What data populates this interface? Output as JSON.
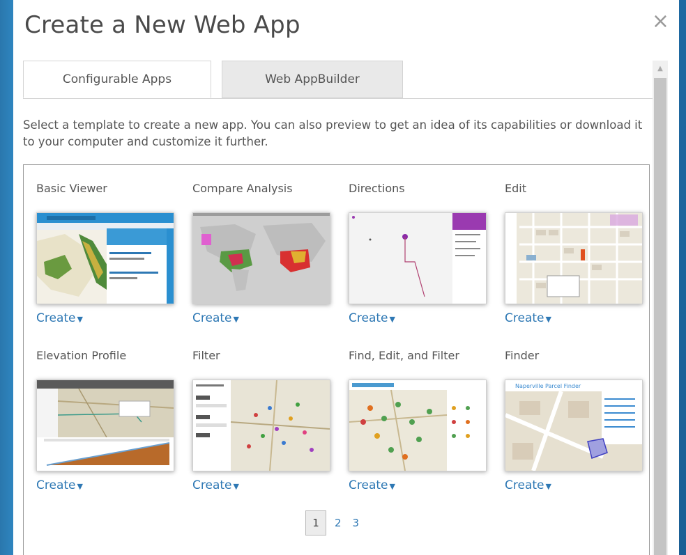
{
  "dialog": {
    "title": "Create a New Web App",
    "close_symbol": "×",
    "tabs": [
      {
        "label": "Configurable Apps",
        "active": true
      },
      {
        "label": "Web AppBuilder",
        "active": false
      }
    ],
    "description": "Select a template to create a new app. You can also preview to get an idea of its capabilities or download it to your computer and customize it further."
  },
  "templates": [
    {
      "name": "Basic Viewer",
      "action": "Create"
    },
    {
      "name": "Compare Analysis",
      "action": "Create"
    },
    {
      "name": "Directions",
      "action": "Create"
    },
    {
      "name": "Edit",
      "action": "Create"
    },
    {
      "name": "Elevation Profile",
      "action": "Create"
    },
    {
      "name": "Filter",
      "action": "Create"
    },
    {
      "name": "Find, Edit, and Filter",
      "action": "Create"
    },
    {
      "name": "Finder",
      "action": "Create"
    }
  ],
  "caret_symbol": "▼",
  "thumbnail_text": {
    "finder_header": "Naperville Parcel Finder"
  },
  "pagination": {
    "pages": [
      "1",
      "2",
      "3"
    ],
    "current": "1"
  },
  "colors": {
    "link": "#2e78b4",
    "background": "#2b7fb8"
  }
}
